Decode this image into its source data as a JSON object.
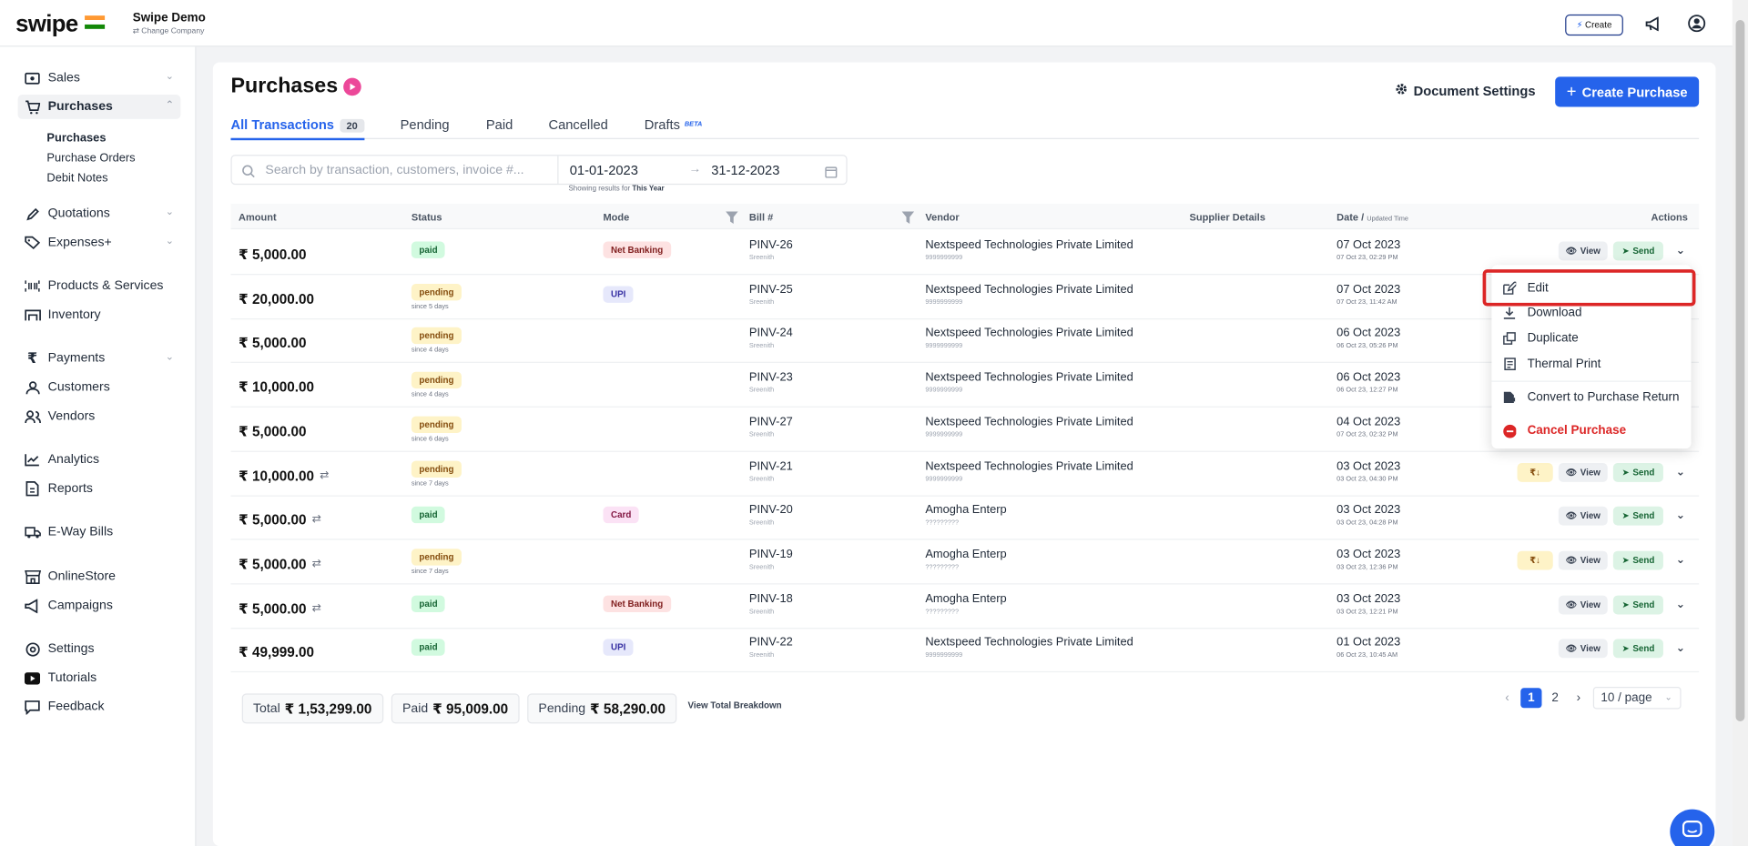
{
  "app": {
    "logo": "swipe",
    "company_name": "Swipe Demo",
    "change_company": "Change Company",
    "create_label": "Create",
    "accent_color": "#2563eb"
  },
  "sidebar": {
    "items": [
      {
        "label": "Sales",
        "icon": "cash-icon"
      },
      {
        "label": "Purchases",
        "icon": "cart-icon"
      },
      {
        "label": "Quotations",
        "icon": "pen-icon"
      },
      {
        "label": "Expenses+",
        "icon": "tag-icon"
      },
      {
        "label": "Products & Services",
        "icon": "barcode-icon"
      },
      {
        "label": "Inventory",
        "icon": "warehouse-icon"
      },
      {
        "label": "Payments",
        "icon": "rupee-icon"
      },
      {
        "label": "Customers",
        "icon": "user-icon"
      },
      {
        "label": "Vendors",
        "icon": "users-icon"
      },
      {
        "label": "Analytics",
        "icon": "chart-icon"
      },
      {
        "label": "Reports",
        "icon": "report-icon"
      },
      {
        "label": "E-Way Bills",
        "icon": "truck-icon"
      },
      {
        "label": "OnlineStore",
        "icon": "store-icon"
      },
      {
        "label": "Campaigns",
        "icon": "megaphone-icon"
      },
      {
        "label": "Settings",
        "icon": "settings-icon"
      },
      {
        "label": "Tutorials",
        "icon": "youtube-icon"
      },
      {
        "label": "Feedback",
        "icon": "message-icon"
      }
    ],
    "purchases_sub": [
      "Purchases",
      "Purchase Orders",
      "Debit Notes"
    ]
  },
  "page": {
    "title": "Purchases",
    "document_settings": "Document Settings",
    "create_purchase": "Create Purchase"
  },
  "tabs": [
    {
      "label": "All Transactions",
      "count": "20"
    },
    {
      "label": "Pending"
    },
    {
      "label": "Paid"
    },
    {
      "label": "Cancelled"
    },
    {
      "label": "Drafts",
      "badge": "BETA"
    }
  ],
  "filters": {
    "search_placeholder": "Search by transaction, customers, invoice #...",
    "date_from": "01-01-2023",
    "date_to": "31-12-2023",
    "showing_prefix": "Showing results for",
    "showing_period": "This Year"
  },
  "table": {
    "headers": {
      "amount": "Amount",
      "status": "Status",
      "mode": "Mode",
      "bill": "Bill #",
      "vendor": "Vendor",
      "supplier": "Supplier Details",
      "date": "Date /",
      "date_small": "Updated Time",
      "actions": "Actions"
    },
    "view_label": "View",
    "send_label": "Send",
    "rupee_label": "₹↓",
    "rows": [
      {
        "amount": "₹ 5,000.00",
        "repeat": false,
        "status": "paid",
        "since": "",
        "mode": "Net Banking",
        "mode_kind": "net",
        "bill": "PINV-26",
        "bill_sub": "Sreenith",
        "vendor": "Nextspeed Technologies Private Limited",
        "vendor_sub": "9999999999",
        "date": "07 Oct 2023",
        "date_sub": "07 Oct 23, 02:29 PM",
        "rupee": false
      },
      {
        "amount": "₹ 20,000.00",
        "repeat": false,
        "status": "pending",
        "since": "since 5 days",
        "mode": "UPI",
        "mode_kind": "upi",
        "bill": "PINV-25",
        "bill_sub": "Sreenith",
        "vendor": "Nextspeed Technologies Private Limited",
        "vendor_sub": "9999999999",
        "date": "07 Oct 2023",
        "date_sub": "07 Oct 23, 11:42 AM",
        "rupee": false
      },
      {
        "amount": "₹ 5,000.00",
        "repeat": false,
        "status": "pending",
        "since": "since 4 days",
        "mode": "",
        "mode_kind": "",
        "bill": "PINV-24",
        "bill_sub": "Sreenith",
        "vendor": "Nextspeed Technologies Private Limited",
        "vendor_sub": "9999999999",
        "date": "06 Oct 2023",
        "date_sub": "06 Oct 23, 05:26 PM",
        "rupee": false
      },
      {
        "amount": "₹ 10,000.00",
        "repeat": false,
        "status": "pending",
        "since": "since 4 days",
        "mode": "",
        "mode_kind": "",
        "bill": "PINV-23",
        "bill_sub": "Sreenith",
        "vendor": "Nextspeed Technologies Private Limited",
        "vendor_sub": "9999999999",
        "date": "06 Oct 2023",
        "date_sub": "06 Oct 23, 12:27 PM",
        "rupee": false
      },
      {
        "amount": "₹ 5,000.00",
        "repeat": false,
        "status": "pending",
        "since": "since 6 days",
        "mode": "",
        "mode_kind": "",
        "bill": "PINV-27",
        "bill_sub": "Sreenith",
        "vendor": "Nextspeed Technologies Private Limited",
        "vendor_sub": "9999999999",
        "date": "04 Oct 2023",
        "date_sub": "07 Oct 23, 02:32 PM",
        "rupee": false
      },
      {
        "amount": "₹ 10,000.00",
        "repeat": true,
        "status": "pending",
        "since": "since 7 days",
        "mode": "",
        "mode_kind": "",
        "bill": "PINV-21",
        "bill_sub": "Sreenith",
        "vendor": "Nextspeed Technologies Private Limited",
        "vendor_sub": "9999999999",
        "date": "03 Oct 2023",
        "date_sub": "03 Oct 23, 04:30 PM",
        "rupee": true
      },
      {
        "amount": "₹ 5,000.00",
        "repeat": true,
        "status": "paid",
        "since": "",
        "mode": "Card",
        "mode_kind": "card",
        "bill": "PINV-20",
        "bill_sub": "Sreenith",
        "vendor": "Amogha Enterp",
        "vendor_sub": "?????????",
        "date": "03 Oct 2023",
        "date_sub": "03 Oct 23, 04:28 PM",
        "rupee": false
      },
      {
        "amount": "₹ 5,000.00",
        "repeat": true,
        "status": "pending",
        "since": "since 7 days",
        "mode": "",
        "mode_kind": "",
        "bill": "PINV-19",
        "bill_sub": "Sreenith",
        "vendor": "Amogha Enterp",
        "vendor_sub": "?????????",
        "date": "03 Oct 2023",
        "date_sub": "03 Oct 23, 12:36 PM",
        "rupee": true
      },
      {
        "amount": "₹ 5,000.00",
        "repeat": true,
        "status": "paid",
        "since": "",
        "mode": "Net Banking",
        "mode_kind": "net",
        "bill": "PINV-18",
        "bill_sub": "Sreenith",
        "vendor": "Amogha Enterp",
        "vendor_sub": "?????????",
        "date": "03 Oct 2023",
        "date_sub": "03 Oct 23, 12:21 PM",
        "rupee": false
      },
      {
        "amount": "₹ 49,999.00",
        "repeat": false,
        "status": "paid",
        "since": "",
        "mode": "UPI",
        "mode_kind": "upi",
        "bill": "PINV-22",
        "bill_sub": "Sreenith",
        "vendor": "Nextspeed Technologies Private Limited",
        "vendor_sub": "9999999999",
        "date": "01 Oct 2023",
        "date_sub": "06 Oct 23, 10:45 AM",
        "rupee": false
      }
    ]
  },
  "totals": {
    "total_label": "Total",
    "total_value": "₹ 1,53,299.00",
    "paid_label": "Paid",
    "paid_value": "₹ 95,009.00",
    "pending_label": "Pending",
    "pending_value": "₹ 58,290.00",
    "breakdown": "View Total Breakdown"
  },
  "pagination": {
    "prev": "‹",
    "page1": "1",
    "page2": "2",
    "next": "›",
    "per_page": "10 / page"
  },
  "menu": {
    "items": [
      {
        "label": "Edit",
        "icon": "edit-icon"
      },
      {
        "label": "Download",
        "icon": "download-icon"
      },
      {
        "label": "Duplicate",
        "icon": "duplicate-icon"
      },
      {
        "label": "Thermal Print",
        "icon": "thermal-print-icon"
      },
      {
        "label": "Convert to Purchase Return",
        "icon": "convert-icon"
      },
      {
        "label": "Cancel Purchase",
        "icon": "cancel-icon"
      }
    ]
  },
  "colors": {
    "paid_bg": "#d1fadf",
    "pending_bg": "#fef3c7",
    "danger": "#dc2626",
    "highlight": "#dc2626"
  }
}
